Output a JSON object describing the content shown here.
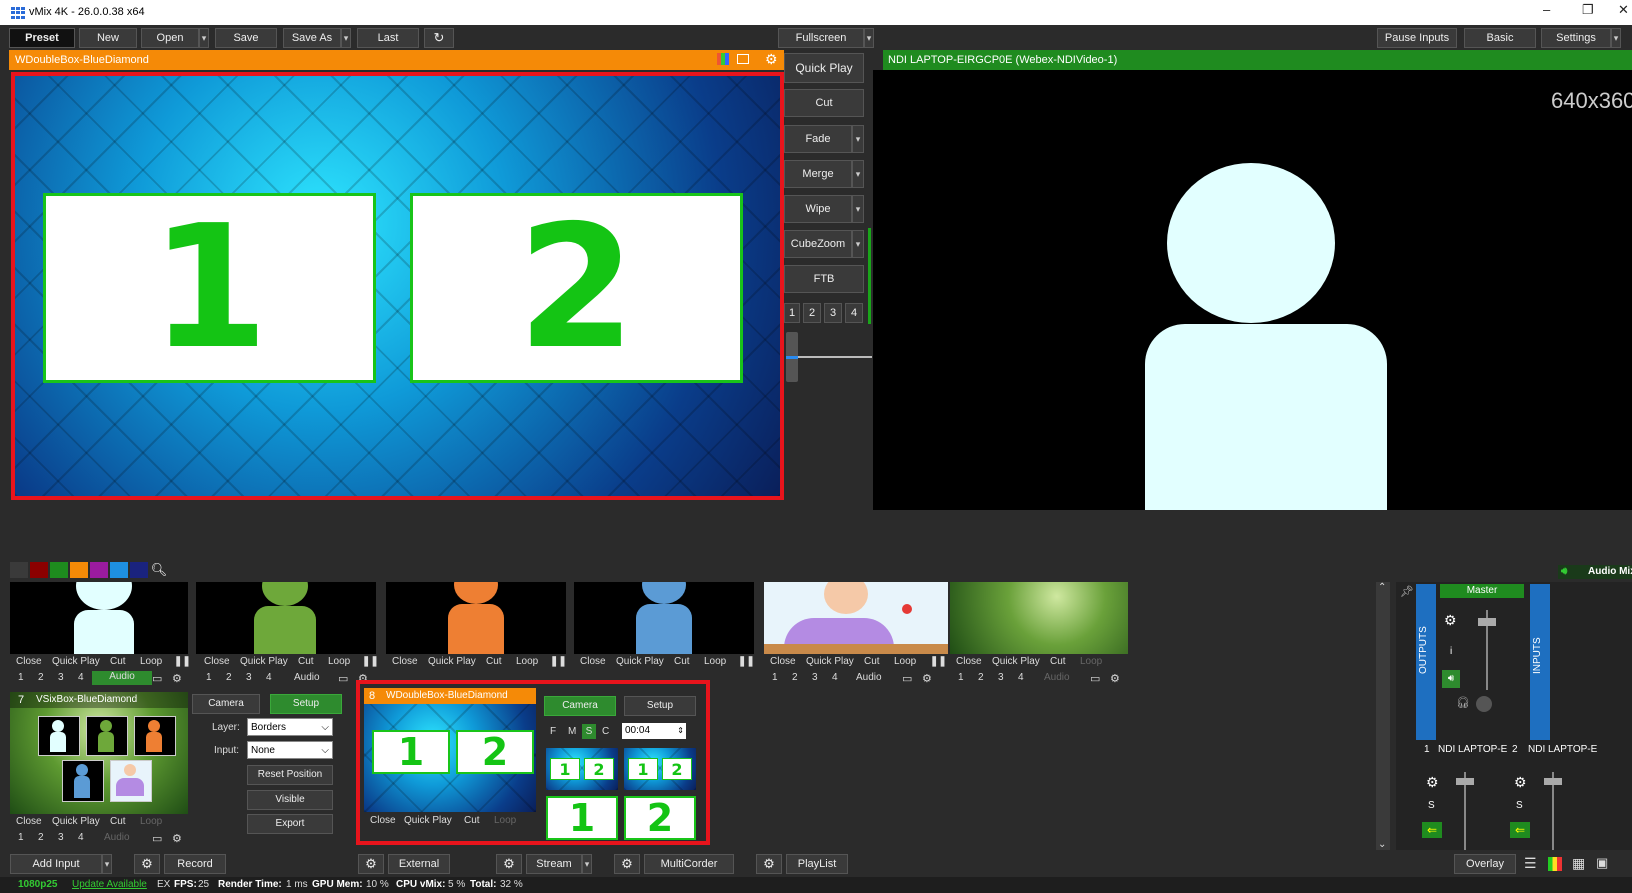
{
  "window": {
    "title": "vMix 4K - 26.0.0.38 x64",
    "minimize": "–",
    "restore": "❐",
    "close": "✕"
  },
  "toolbar": {
    "preset": "Preset",
    "new": "New",
    "open": "Open",
    "save": "Save",
    "save_as": "Save As",
    "last": "Last",
    "fullscreen": "Fullscreen",
    "pause_inputs": "Pause Inputs",
    "basic": "Basic",
    "settings": "Settings"
  },
  "preview": {
    "title": "WDoubleBox-BlueDiamond",
    "box1": "1",
    "box2": "2"
  },
  "transitions": {
    "quick_play": "Quick Play",
    "cut": "Cut",
    "fade": "Fade",
    "merge": "Merge",
    "wipe": "Wipe",
    "cubezoom": "CubeZoom",
    "ftb": "FTB",
    "numbers": [
      "1",
      "2",
      "3",
      "4"
    ]
  },
  "output": {
    "title": "NDI LAPTOP-EIRGCP0E (Webex-NDIVideo-1)",
    "resolution": "640x360"
  },
  "colors": {
    "accent_orange": "#f58a07",
    "accent_green": "#1f8b1f",
    "selection_red": "#e8141c",
    "swatches": [
      "#3a3a3a",
      "#8b0000",
      "#1e8b1e",
      "#f58a07",
      "#9b1ba0",
      "#1e8fe0",
      "#1a237e"
    ]
  },
  "input_ctrl": {
    "close": "Close",
    "quick_play": "Quick Play",
    "cut": "Cut",
    "loop": "Loop",
    "audio": "Audio",
    "nums": [
      "1",
      "2",
      "3",
      "4"
    ]
  },
  "input7": {
    "number": "7",
    "title": "VSixBox-BlueDiamond"
  },
  "input8": {
    "number": "8",
    "title": "WDoubleBox-BlueDiamond",
    "box1": "1",
    "box2": "2"
  },
  "layer_panel": {
    "camera": "Camera",
    "setup": "Setup",
    "layer_label": "Layer:",
    "layer_value": "Borders",
    "input_label": "Input:",
    "input_value": "None",
    "reset_position": "Reset Position",
    "visible": "Visible",
    "export": "Export"
  },
  "input8_panel": {
    "camera": "Camera",
    "setup": "Setup",
    "f": "F",
    "m": "M",
    "s": "S",
    "c": "C",
    "time": "00:04"
  },
  "audio_mixer": {
    "label": "Audio Mix",
    "master": "Master",
    "outputs": "OUTPUTS",
    "inputs": "INPUTS",
    "ch1_num": "1",
    "ch1_name": "NDI LAPTOP-E",
    "ch2_num": "2",
    "ch2_name": "NDI LAPTOP-E",
    "s": "S",
    "i": "i"
  },
  "bottombar": {
    "add_input": "Add Input",
    "record": "Record",
    "external": "External",
    "stream": "Stream",
    "multicorder": "MultiCorder",
    "playlist": "PlayList",
    "overlay": "Overlay"
  },
  "status": {
    "format": "1080p25",
    "update": "Update Available",
    "ex": "EX",
    "fps_label": "FPS:",
    "fps": "25",
    "render_label": "Render Time:",
    "render": "1 ms",
    "gpu_label": "GPU Mem:",
    "gpu": "10 %",
    "cpu_label": "CPU vMix:",
    "cpu": "5 %",
    "total_label": "Total:",
    "total": "32 %"
  }
}
